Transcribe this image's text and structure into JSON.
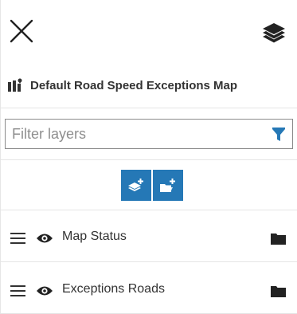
{
  "window": {
    "accent_color": "#2578b6",
    "icon_color": "#222222"
  },
  "header": {
    "close_icon": "close-icon",
    "layers_icon": "layers-icon"
  },
  "title": {
    "icon": "map-icon",
    "text": "Default Road Speed Exceptions Map"
  },
  "filter": {
    "value": "",
    "placeholder": "Filter layers",
    "icon": "filter-funnel-icon",
    "icon_color": "#2578b6"
  },
  "toolbar": {
    "buttons": [
      {
        "icon": "add-layer-icon"
      },
      {
        "icon": "add-folder-icon"
      }
    ]
  },
  "layers": [
    {
      "label": "Map Status",
      "visible": true
    },
    {
      "label": "Exceptions Roads",
      "visible": true
    }
  ]
}
